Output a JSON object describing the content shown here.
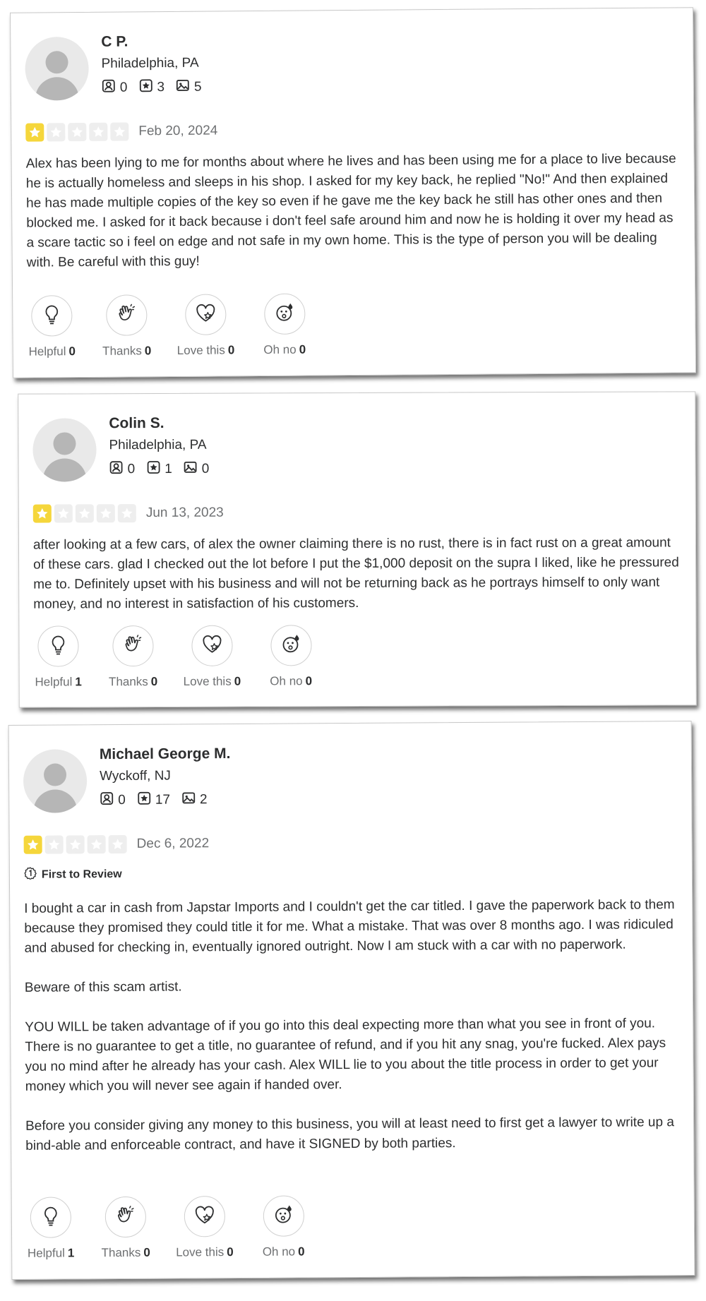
{
  "reviews": [
    {
      "name": "C P.",
      "location": "Philadelphia, PA",
      "friends": "0",
      "reviews_count": "3",
      "photos": "5",
      "rating": 1,
      "date": "Feb 20, 2024",
      "badge": "",
      "paragraphs": [
        "Alex has been lying to me for months about where he lives and has been using me for a place to live because he is actually homeless and sleeps in his shop. I asked for my key back, he replied \"No!\" And then explained he has made multiple copies of the key so even if he gave me the key back he still has other ones and then blocked me. I asked for it back because i don't feel safe around him and now he is holding it over my head as a scare tactic so i feel on edge and not safe in my own home. This is the type of person you will be dealing with. Be careful with this guy!"
      ],
      "reactions": [
        {
          "label": "Helpful",
          "count": "0",
          "icon": "lightbulb-icon"
        },
        {
          "label": "Thanks",
          "count": "0",
          "icon": "clapping-hands-icon"
        },
        {
          "label": "Love this",
          "count": "0",
          "icon": "heart-icon"
        },
        {
          "label": "Oh no",
          "count": "0",
          "icon": "shocked-face-icon"
        }
      ]
    },
    {
      "name": "Colin S.",
      "location": "Philadelphia, PA",
      "friends": "0",
      "reviews_count": "1",
      "photos": "0",
      "rating": 1,
      "date": "Jun 13, 2023",
      "badge": "",
      "paragraphs": [
        "after looking at a few cars, of alex the owner claiming there is no rust, there is in fact rust on a great amount of these cars. glad I checked out the lot before I put the $1,000 deposit on the supra I liked, like he pressured me to. Definitely upset with his business and will not be returning back as he portrays himself to only want money, and no interest in satisfaction of his customers."
      ],
      "reactions": [
        {
          "label": "Helpful",
          "count": "1",
          "icon": "lightbulb-icon"
        },
        {
          "label": "Thanks",
          "count": "0",
          "icon": "clapping-hands-icon"
        },
        {
          "label": "Love this",
          "count": "0",
          "icon": "heart-icon"
        },
        {
          "label": "Oh no",
          "count": "0",
          "icon": "shocked-face-icon"
        }
      ]
    },
    {
      "name": "Michael George M.",
      "location": "Wyckoff, NJ",
      "friends": "0",
      "reviews_count": "17",
      "photos": "2",
      "rating": 1,
      "date": "Dec 6, 2022",
      "badge": "First to Review",
      "paragraphs": [
        "I bought a car in cash from Japstar Imports and I couldn't get the car titled. I gave the paperwork back to them because they promised they could title it for me. What a mistake. That was over 8 months ago. I was ridiculed and abused for checking in, eventually ignored outright. Now I am stuck with a car with no paperwork.",
        "Beware of this scam artist.",
        "YOU WILL be taken advantage of if you go into this deal expecting more than what you see in front of you. There is no guarantee to get a title, no guarantee of refund, and if you hit any snag, you're fucked. Alex pays you no mind after he already has your cash. Alex WILL lie to you about the title process in order to get your money which you will never see again if handed over.",
        "Before you consider giving any money to this business, you will at least need to first get a lawyer to write up a bind-able and enforceable contract, and have it SIGNED by both parties."
      ],
      "reactions": [
        {
          "label": "Helpful",
          "count": "1",
          "icon": "lightbulb-icon"
        },
        {
          "label": "Thanks",
          "count": "0",
          "icon": "clapping-hands-icon"
        },
        {
          "label": "Love this",
          "count": "0",
          "icon": "heart-icon"
        },
        {
          "label": "Oh no",
          "count": "0",
          "icon": "shocked-face-icon"
        }
      ]
    }
  ],
  "colors": {
    "star_filled": "#f5d63b",
    "star_empty": "#eeeeee",
    "text": "#2d2e2f",
    "muted": "#6e7072"
  }
}
